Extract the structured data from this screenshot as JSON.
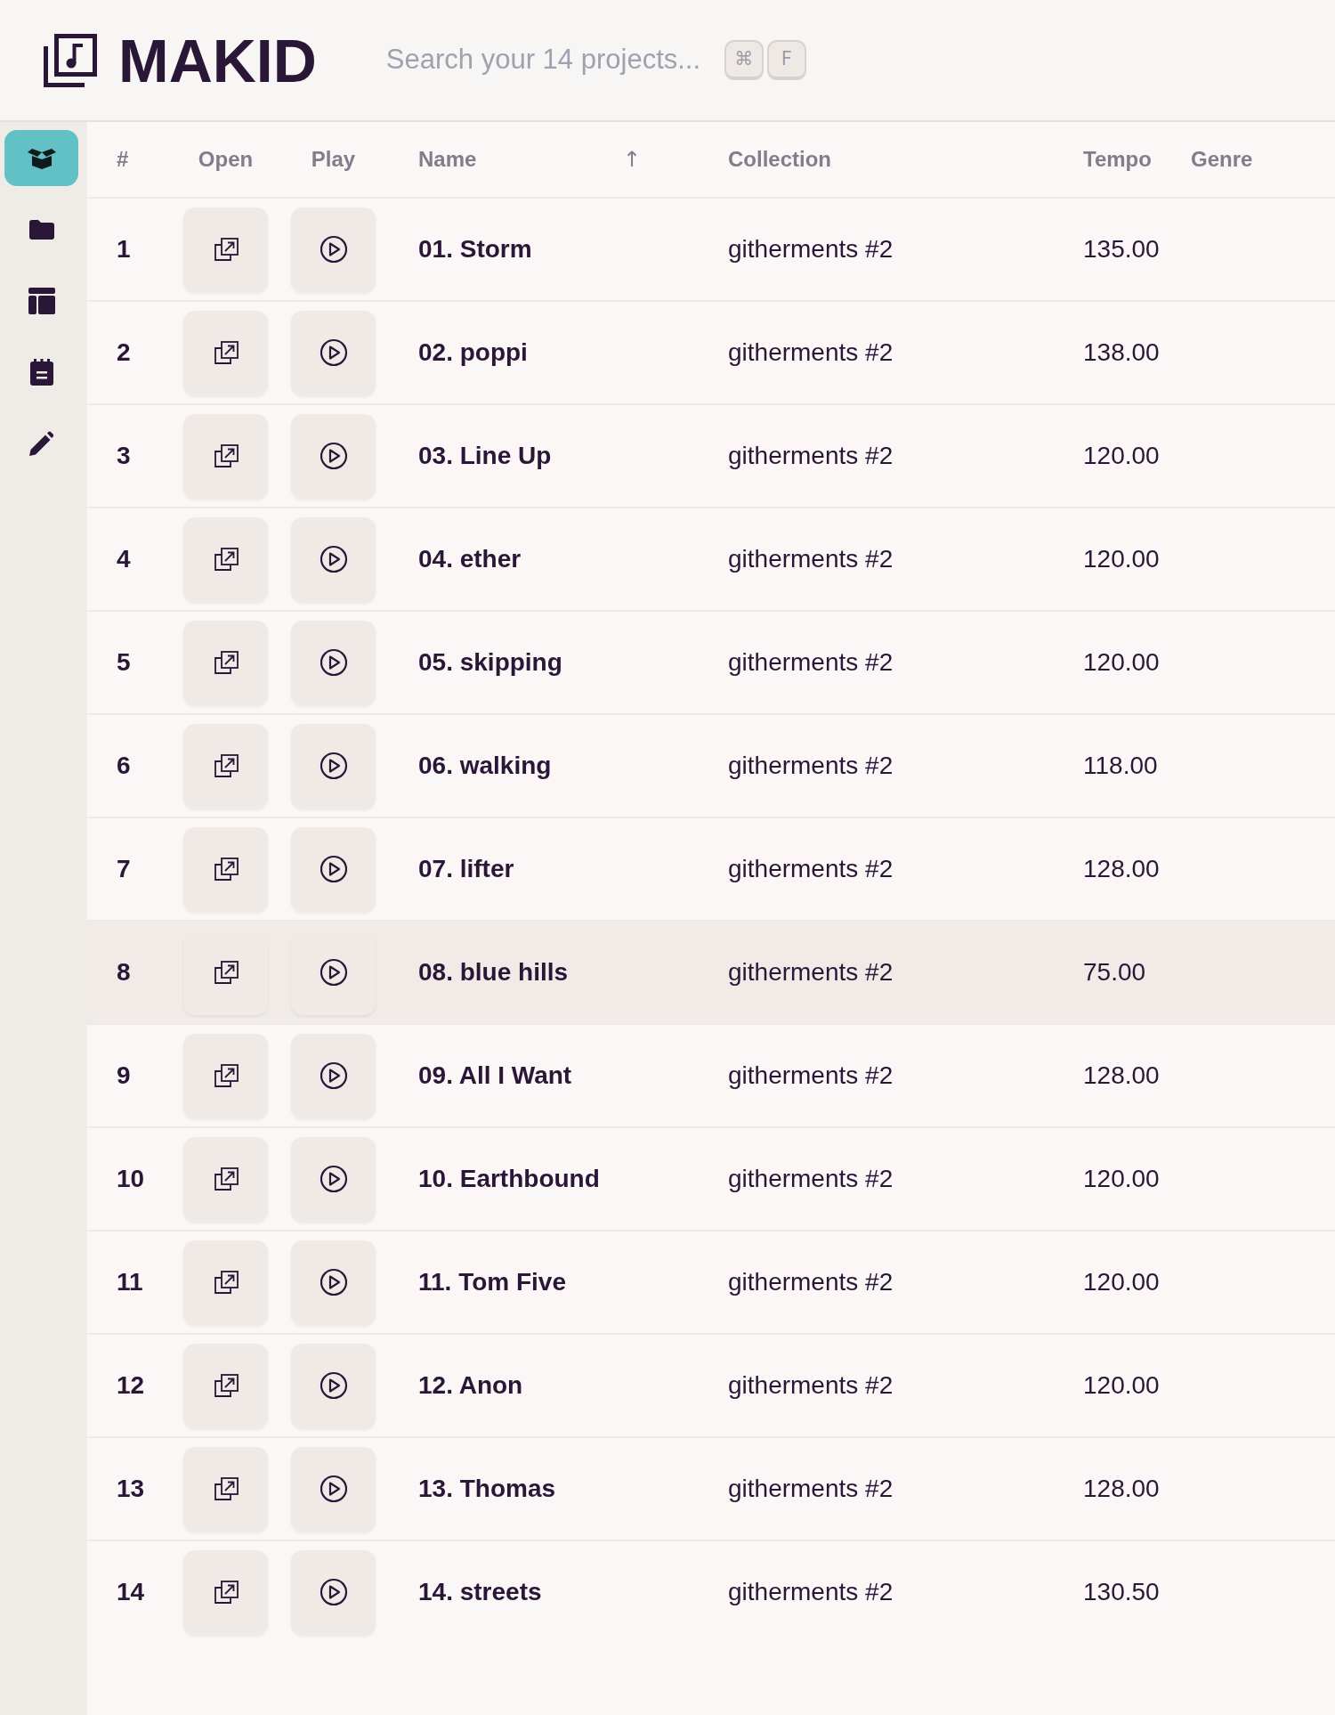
{
  "app": {
    "logo_text": "MAKID"
  },
  "search": {
    "placeholder": "Search your 14 projects...",
    "shortcut_keys": [
      "⌘",
      "F"
    ]
  },
  "sidebar": {
    "items": [
      {
        "selected": true
      },
      {
        "selected": false
      },
      {
        "selected": false
      },
      {
        "selected": false
      },
      {
        "selected": false
      }
    ]
  },
  "table": {
    "columns": [
      {
        "label": "#"
      },
      {
        "label": "Open"
      },
      {
        "label": "Play"
      },
      {
        "label": "Name",
        "sort_indicator": "↑"
      },
      {
        "label": "Collection"
      },
      {
        "label": "Tempo"
      },
      {
        "label": "Genre"
      }
    ],
    "rows": [
      {
        "number": "1",
        "name": "01. Storm",
        "collection": "githerments #2",
        "tempo": "135.00",
        "selected": false
      },
      {
        "number": "2",
        "name": "02. poppi",
        "collection": "githerments #2",
        "tempo": "138.00",
        "selected": false
      },
      {
        "number": "3",
        "name": "03. Line Up",
        "collection": "githerments #2",
        "tempo": "120.00",
        "selected": false
      },
      {
        "number": "4",
        "name": "04. ether",
        "collection": "githerments #2",
        "tempo": "120.00",
        "selected": false
      },
      {
        "number": "5",
        "name": "05. skipping",
        "collection": "githerments #2",
        "tempo": "120.00",
        "selected": false
      },
      {
        "number": "6",
        "name": "06. walking",
        "collection": "githerments #2",
        "tempo": "118.00",
        "selected": false
      },
      {
        "number": "7",
        "name": "07. lifter",
        "collection": "githerments #2",
        "tempo": "128.00",
        "selected": false
      },
      {
        "number": "8",
        "name": "08. blue hills",
        "collection": "githerments #2",
        "tempo": "75.00",
        "selected": true
      },
      {
        "number": "9",
        "name": "09. All I Want",
        "collection": "githerments #2",
        "tempo": "128.00",
        "selected": false
      },
      {
        "number": "10",
        "name": "10. Earthbound",
        "collection": "githerments #2",
        "tempo": "120.00",
        "selected": false
      },
      {
        "number": "11",
        "name": "11. Tom Five",
        "collection": "githerments #2",
        "tempo": "120.00",
        "selected": false
      },
      {
        "number": "12",
        "name": "12. Anon",
        "collection": "githerments #2",
        "tempo": "120.00",
        "selected": false
      },
      {
        "number": "13",
        "name": "13. Thomas",
        "collection": "githerments #2",
        "tempo": "128.00",
        "selected": false
      },
      {
        "number": "14",
        "name": "14. streets",
        "collection": "githerments #2",
        "tempo": "130.50",
        "selected": false
      }
    ]
  }
}
